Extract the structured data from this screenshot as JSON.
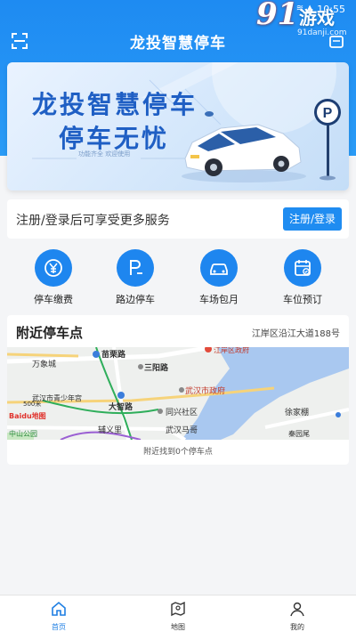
{
  "status": {
    "time": "10:55",
    "signal": "≋ ▲"
  },
  "watermark": {
    "logo": "91",
    "name": "游戏",
    "url": "91danji.com"
  },
  "header": {
    "title": "龙投智慧停车"
  },
  "banner": {
    "line1": "龙投智慧停车",
    "line2": "停车无忧",
    "tagline": "功能齐全 欢迎使用",
    "sign_letter": "P"
  },
  "login": {
    "prompt": "注册/登录后可享受更多服务",
    "button": "注册/登录"
  },
  "services": [
    {
      "label": "停车缴费",
      "icon": "yuan-coin-icon"
    },
    {
      "label": "路边停车",
      "icon": "roadside-parking-icon"
    },
    {
      "label": "车场包月",
      "icon": "car-icon"
    },
    {
      "label": "车位预订",
      "icon": "calendar-check-icon"
    }
  ],
  "nearby": {
    "title": "附近停车点",
    "address": "江岸区沿江大道188号",
    "result": "附近找到0个停车点",
    "map_labels": {
      "l1": "万象城",
      "l2": "苗栗路",
      "l3": "三阳路",
      "l4": "江岸区政府",
      "l5": "武汉市政府",
      "l6": "武汉市青少年宫",
      "l7": "大智路",
      "l8": "同兴社区",
      "l9": "徐家棚",
      "l10": "辅义里",
      "l11": "武汉马哥",
      "l12": "秦园尾",
      "l13": "中山公园",
      "l14": "500米",
      "l15": "Baidu地图"
    }
  },
  "tabs": [
    {
      "label": "首页",
      "icon": "home-icon",
      "active": true
    },
    {
      "label": "地图",
      "icon": "map-icon",
      "active": false
    },
    {
      "label": "我的",
      "icon": "user-icon",
      "active": false
    }
  ],
  "colors": {
    "primary": "#1f8cf1",
    "river": "#a9c8f0"
  }
}
